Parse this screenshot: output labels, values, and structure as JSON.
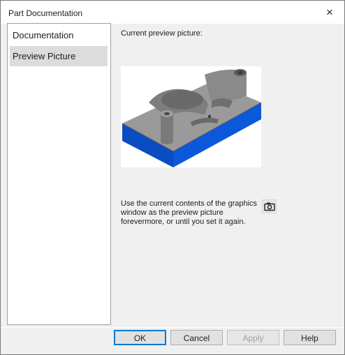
{
  "window": {
    "title": "Part Documentation",
    "close_glyph": "×"
  },
  "nav": {
    "items": [
      {
        "label": "Documentation"
      },
      {
        "label": "Preview Picture",
        "selected": true
      }
    ]
  },
  "preview": {
    "label": "Current preview picture:",
    "description_lines": [
      "Use the current contents of the graphics",
      "window as the preview picture",
      "forevermore, or until you set it again."
    ],
    "set_button_icon": "camera-icon"
  },
  "buttons": {
    "ok": "OK",
    "cancel": "Cancel",
    "apply": "Apply",
    "help": "Help"
  },
  "colors": {
    "base_blue": "#0b50c8",
    "part_gray": "#8c8c8c",
    "selection": "#dcdcdc"
  }
}
